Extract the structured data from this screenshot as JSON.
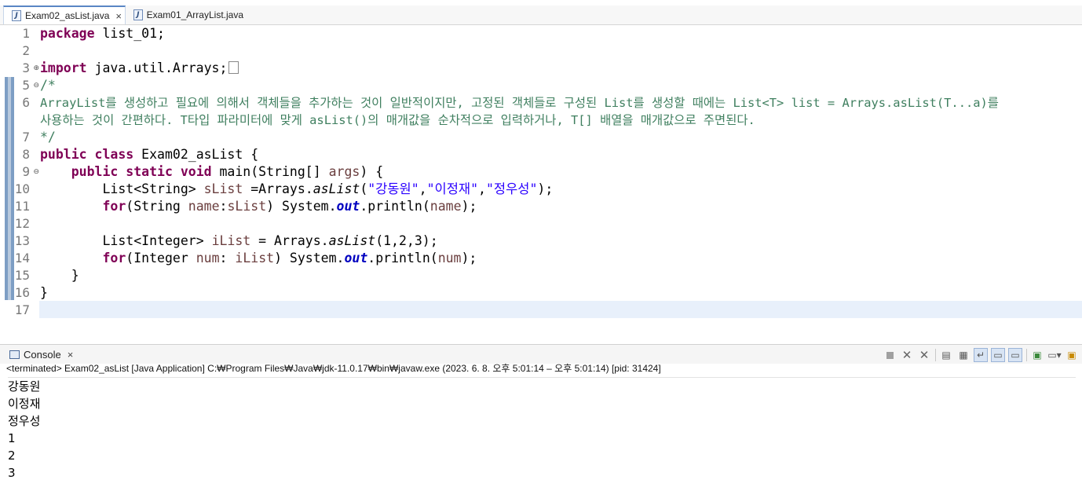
{
  "tabs": [
    {
      "label": "Exam02_asList.java",
      "close": "×"
    },
    {
      "label": "Exam01_ArrayList.java"
    }
  ],
  "line_numbers": [
    "1",
    "2",
    "3",
    "5",
    "6",
    "7",
    "8",
    "9",
    "10",
    "11",
    "12",
    "13",
    "14",
    "15",
    "16",
    "17"
  ],
  "code": {
    "l1_kw": "package",
    "l1_rest": " list_01;",
    "l3_kw": "import",
    "l3_rest": " java.util.Arrays;",
    "l5": "/*",
    "l6a": "ArrayList를 생성하고 필요에 의해서 객체들을 추가하는 것이 일반적이지만, 고정된 객체들로 구성된 List를 생성할 때에는 List<T> list = Arrays.asList(T...a)를",
    "l6b": "사용하는 것이 간편하다. T타입 파라미터에 맞게 asList()의 매개값을 순차적으로 입력하거나, T[] 배열을 매개값으로 주면된다.",
    "l7": "*/",
    "l8_kw": "public class",
    "l8_rest": " Exam02_asList {",
    "l9_kw": "public static void",
    "l9_rest1": " main(String[] ",
    "l9_var": "args",
    "l9_rest2": ") {",
    "l10_a": "List<String> ",
    "l10_var": "sList",
    "l10_b": " =Arrays.",
    "l10_static": "asList",
    "l10_c": "(",
    "l10_s1": "\"강동원\"",
    "l10_s2": "\"이정재\"",
    "l10_s3": "\"정우성\"",
    "l10_d": ");",
    "l11_kw": "for",
    "l11_a": "(String ",
    "l11_var1": "name",
    "l11_b": ":",
    "l11_var2": "sList",
    "l11_c": ") System.",
    "l11_fld": "out",
    "l11_d": ".println(",
    "l11_var3": "name",
    "l11_e": ");",
    "l13_a": "List<Integer> ",
    "l13_var": "iList",
    "l13_b": " = Arrays.",
    "l13_static": "asList",
    "l13_c": "(1,2,3);",
    "l14_kw": "for",
    "l14_a": "(Integer ",
    "l14_var1": "num",
    "l14_b": ": ",
    "l14_var2": "iList",
    "l14_c": ") System.",
    "l14_fld": "out",
    "l14_d": ".println(",
    "l14_var3": "num",
    "l14_e": ");",
    "l15": "}",
    "l16": "}"
  },
  "console": {
    "tab_label": "Console",
    "tab_close": "×",
    "status": "<terminated> Exam02_asList [Java Application] C:₩Program Files₩Java₩jdk-11.0.17₩bin₩javaw.exe  (2023. 6. 8. 오후 5:01:14 – 오후 5:01:14) [pid: 31424]",
    "output": [
      "강동원",
      "이정재",
      "정우성",
      "1",
      "2",
      "3"
    ]
  },
  "toolbar_icons": [
    "terminate-icon",
    "remove-launch-icon",
    "remove-all-terminated-icon",
    "clear-console-icon",
    "scroll-lock-icon",
    "word-wrap-icon",
    "show-on-stdout-icon",
    "show-on-stderr-icon",
    "pin-console-icon",
    "display-console-icon",
    "open-console-icon"
  ]
}
